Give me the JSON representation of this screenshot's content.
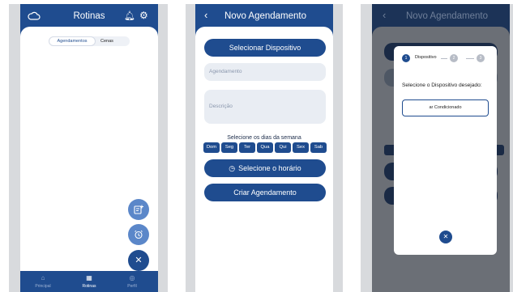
{
  "screen1": {
    "title": "Rotinas",
    "tabs": [
      {
        "label": "Agendamentos",
        "active": true
      },
      {
        "label": "Cenas",
        "active": false
      }
    ],
    "fabs": [
      "add-schedule-icon",
      "alarm-icon",
      "close-icon"
    ],
    "nav": [
      {
        "label": "Principal",
        "icon": "home-icon",
        "active": false
      },
      {
        "label": "Rotinas",
        "icon": "calendar-icon",
        "active": true
      },
      {
        "label": "Perfil",
        "icon": "profile-icon",
        "active": false
      }
    ]
  },
  "screen2": {
    "title": "Novo Agendamento",
    "select_device_label": "Selecionar Dispositivo",
    "name_placeholder": "Agendamento",
    "description_placeholder": "Descrição",
    "days_label": "Selecione os dias da semana",
    "days": [
      "Dom",
      "Seg",
      "Ter",
      "Qua",
      "Qui",
      "Sex",
      "Sab"
    ],
    "time_button_label": "Selecione o horário",
    "create_button_label": "Criar Agendamento"
  },
  "screen3": {
    "title": "Novo Agendamento",
    "steps": [
      {
        "number": "1",
        "label": "Dispositivo",
        "active": true
      },
      {
        "number": "2",
        "label": "",
        "active": false
      },
      {
        "number": "3",
        "label": "",
        "active": false
      }
    ],
    "question": "Selecione o Dispositivo desejado:",
    "selected_device": "ar Condicionado"
  },
  "colors": {
    "primary": "#1f4c8f",
    "fab_light": "#5b87c9",
    "field_bg": "#e9edf3",
    "overlay": "#1a2a45"
  }
}
